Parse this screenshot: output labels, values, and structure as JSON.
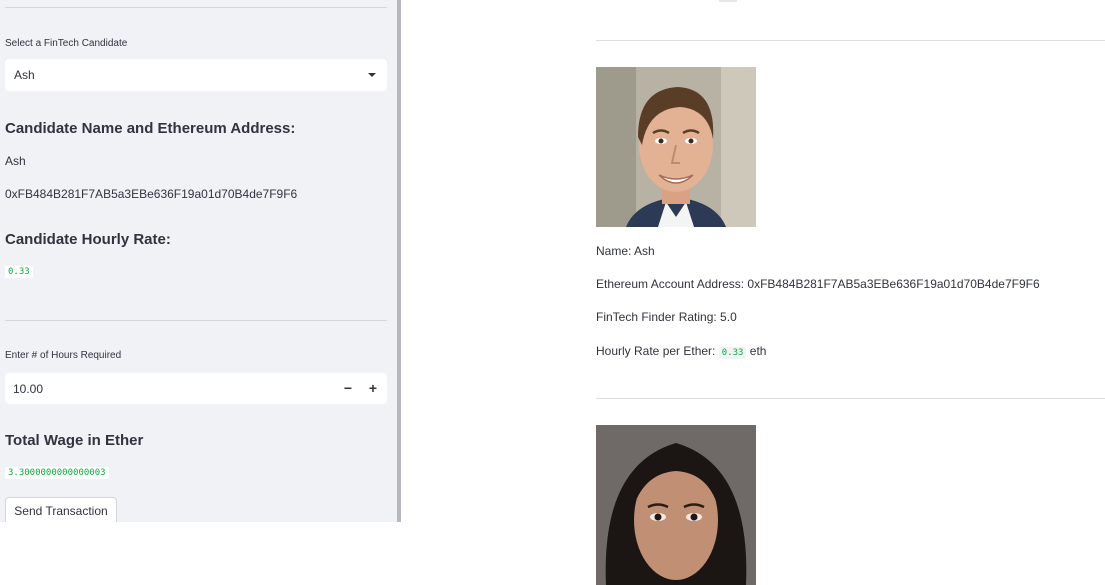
{
  "sidebar": {
    "select_label": "Select a FinTech Candidate",
    "selected_candidate": "Ash",
    "name_address_heading": "Candidate Name and Ethereum Address:",
    "candidate_name": "Ash",
    "candidate_address": "0xFB484B281F7AB5a3EBe636F19a01d70B4de7F9F6",
    "hourly_rate_heading": "Candidate Hourly Rate:",
    "hourly_rate": "0.33",
    "hours_label": "Enter # of Hours Required",
    "hours_value": "10.00",
    "minus_label": "−",
    "plus_label": "+",
    "total_wage_heading": "Total Wage in Ether",
    "total_wage": "3.3000000000000003",
    "send_button": "Send Transaction"
  },
  "main": {
    "candidates": [
      {
        "name_line": "Name: Ash",
        "address_line": "Ethereum Account Address: 0xFB484B281F7AB5a3EBe636F19a01d70B4de7F9F6",
        "rating_line": "FinTech Finder Rating: 5.0",
        "rate_prefix": "Hourly Rate per Ether:",
        "rate_value": "0.33",
        "rate_suffix": "eth"
      }
    ]
  },
  "icons": {
    "select_caret": "caret-down-icon",
    "decrement": "minus-icon",
    "increment": "plus-icon"
  }
}
